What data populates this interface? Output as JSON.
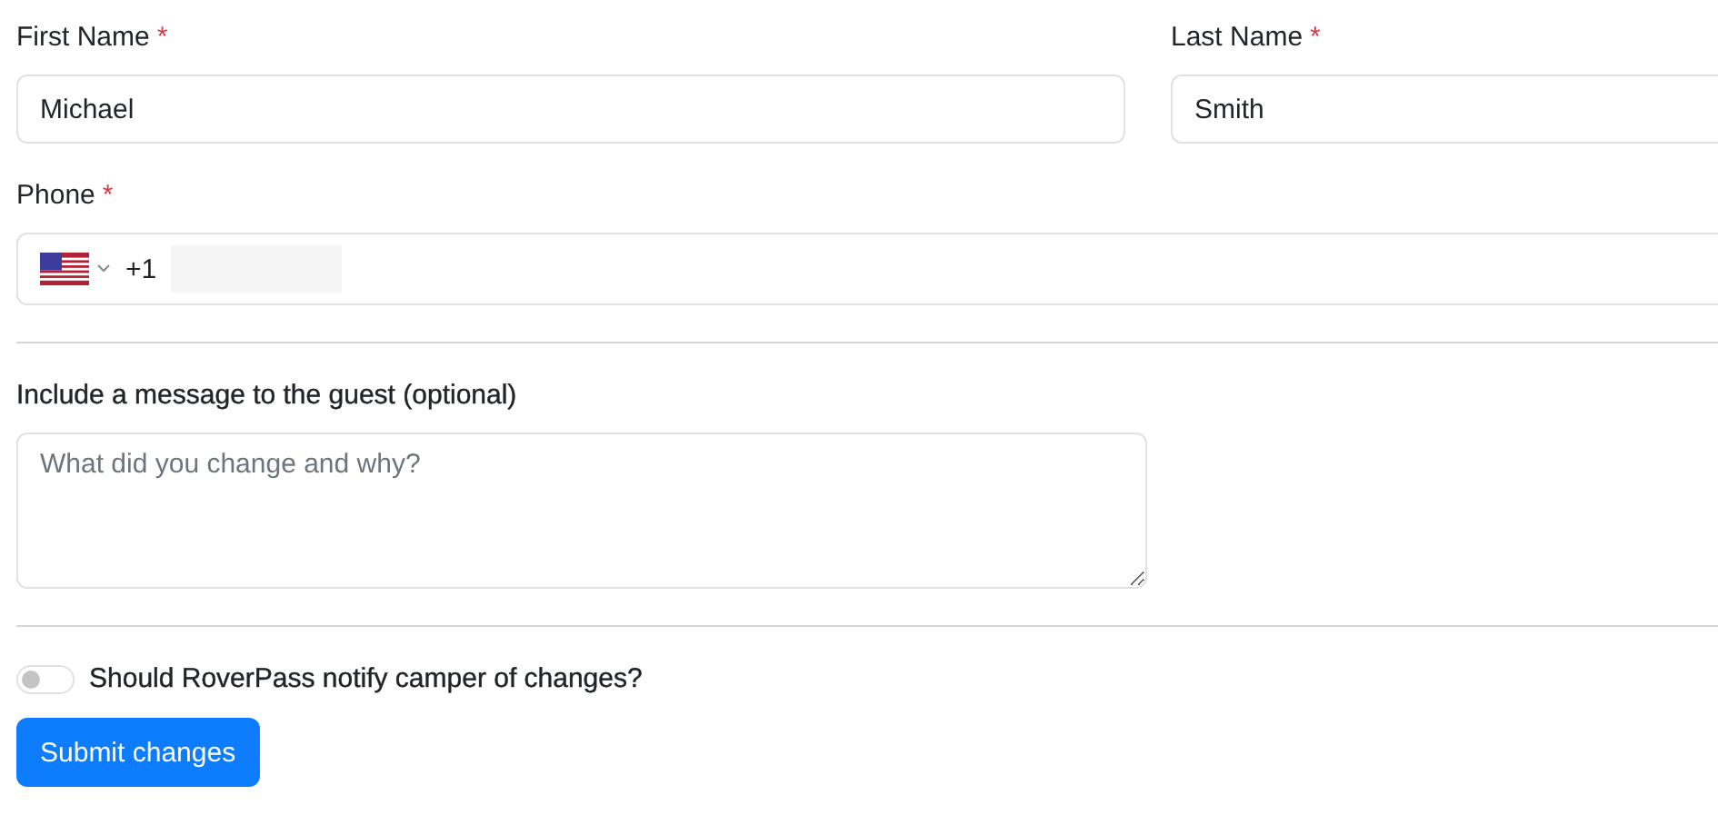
{
  "name_fields": [
    {
      "label": "First Name",
      "mark": "*",
      "value": "Michael"
    },
    {
      "label": "Last Name",
      "mark": "*",
      "value": "Smith"
    }
  ],
  "phone": {
    "label": "Phone",
    "mark": "*",
    "dial_code": "+1"
  },
  "message": {
    "label": "Include a message to the guest (optional)",
    "placeholder": "What did you change and why?"
  },
  "notify": {
    "label": "Should RoverPass notify camper of changes?",
    "on": false
  },
  "submit": "Submit changes"
}
